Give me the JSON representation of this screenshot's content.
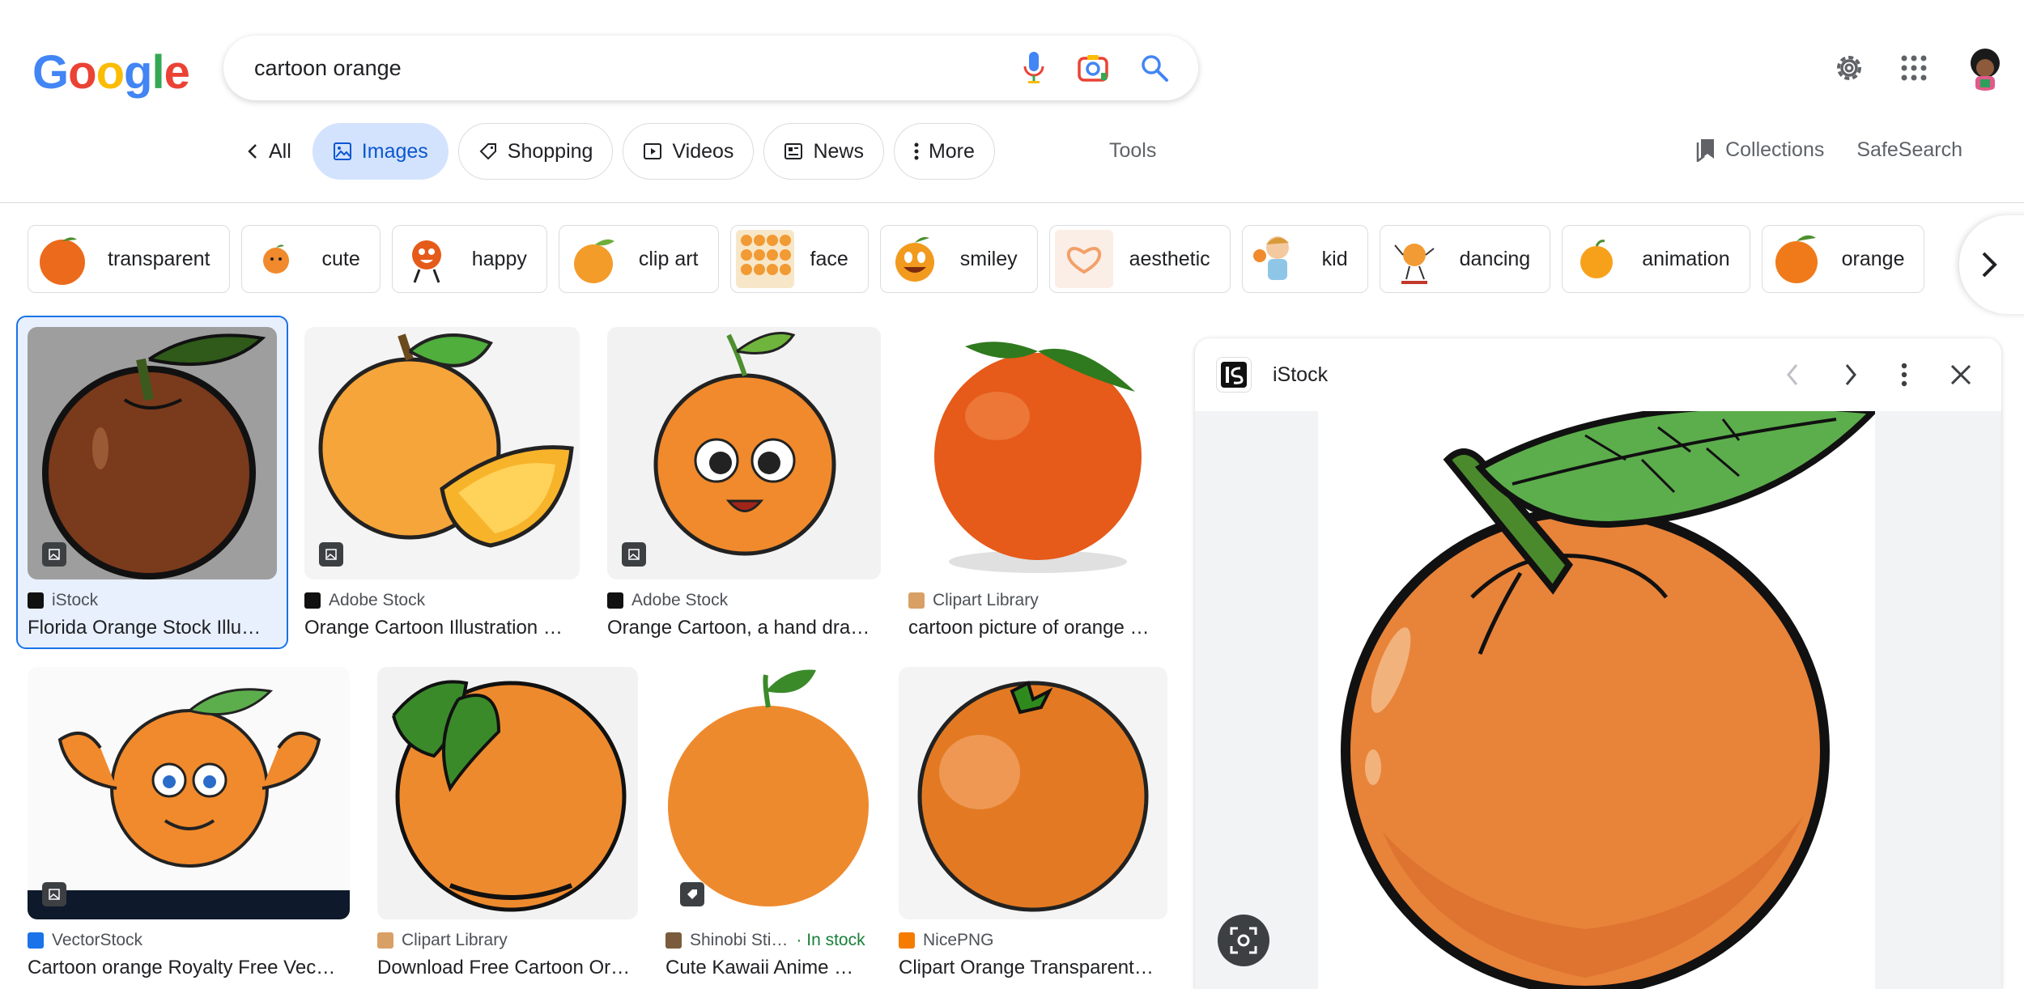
{
  "search": {
    "query": "cartoon orange"
  },
  "logo": {
    "letters": [
      "G",
      "o",
      "o",
      "g",
      "l",
      "e"
    ],
    "colors": [
      "#4285f4",
      "#ea4335",
      "#fbbc05",
      "#4285f4",
      "#34a853",
      "#ea4335"
    ]
  },
  "nav": {
    "all": "All",
    "tabs": [
      {
        "label": "Images",
        "active": true
      },
      {
        "label": "Shopping"
      },
      {
        "label": "Videos"
      },
      {
        "label": "News"
      },
      {
        "label": "More"
      }
    ],
    "tools": "Tools",
    "collections": "Collections",
    "safesearch": "SafeSearch"
  },
  "chips": [
    "transparent",
    "cute",
    "happy",
    "clip art",
    "face",
    "smiley",
    "aesthetic",
    "kid",
    "dancing",
    "animation",
    "orange"
  ],
  "results": [
    {
      "source": "iStock",
      "title": "Florida Orange Stock Illu…",
      "favicon": "#111111"
    },
    {
      "source": "Adobe Stock",
      "title": "Orange Cartoon Illustration …",
      "favicon": "#111111"
    },
    {
      "source": "Adobe Stock",
      "title": "Orange Cartoon, a hand dra…",
      "favicon": "#111111"
    },
    {
      "source": "Clipart Library",
      "title": "cartoon picture of orange …",
      "favicon": "#d9a066"
    },
    {
      "source": "VectorStock",
      "title": "Cartoon orange Royalty Free Vec…",
      "favicon": "#1a73e8"
    },
    {
      "source": "Clipart Library",
      "title": "Download Free Cartoon Or…",
      "favicon": "#d9a066"
    },
    {
      "source": "Shinobi Sti…",
      "stock": "· In stock",
      "title": "Cute Kawaii Anime …",
      "favicon": "#7a5c3c"
    },
    {
      "source": "NicePNG",
      "title": "Clipart Orange Transparent…",
      "favicon": "#f57c00"
    }
  ],
  "preview": {
    "source": "iStock"
  },
  "colors": {
    "accent": "#1a73e8",
    "orange": "#e8833a",
    "leaf": "#5cae4c"
  }
}
